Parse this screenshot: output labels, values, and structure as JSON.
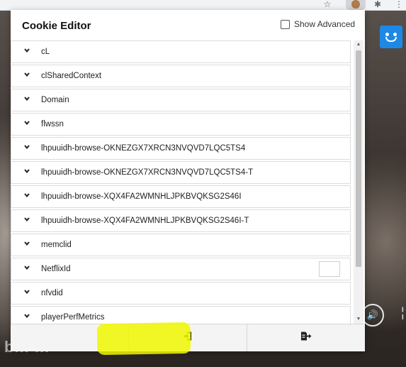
{
  "popup": {
    "title": "Cookie Editor",
    "show_advanced_label": "Show Advanced",
    "show_advanced_checked": false
  },
  "cookies": [
    {
      "name": "cL"
    },
    {
      "name": "clSharedContext"
    },
    {
      "name": "Domain"
    },
    {
      "name": "flwssn"
    },
    {
      "name": "lhpuuidh-browse-OKNEZGX7XRCN3NVQVD7LQC5TS4"
    },
    {
      "name": "lhpuuidh-browse-OKNEZGX7XRCN3NVQVD7LQC5TS4-T"
    },
    {
      "name": "lhpuuidh-browse-XQX4FA2WMNHLJPKBVQKSG2S46I"
    },
    {
      "name": "lhpuuidh-browse-XQX4FA2WMNHLJPKBVQKSG2S46I-T"
    },
    {
      "name": "memclid"
    },
    {
      "name": "NetflixId"
    },
    {
      "name": "nfvdid"
    },
    {
      "name": "playerPerfMetrics"
    }
  ],
  "icons": {
    "expand": "chevron-down-icon",
    "add": "add-icon",
    "import": "import-icon",
    "export": "export-icon"
  },
  "colors": {
    "highlight": "#f0f700",
    "list_border": "#dcdcdc",
    "footer": "#f4f4f4"
  }
}
